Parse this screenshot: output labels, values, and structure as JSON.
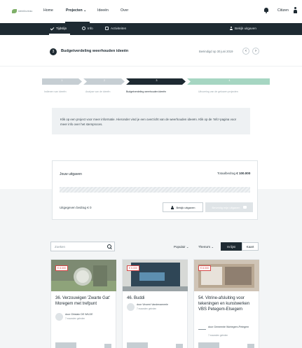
{
  "nav": {
    "logo_text": "stembureau",
    "links": [
      "Home",
      "Projecten",
      "Ideeën",
      "Over"
    ],
    "projecten_caret": "⌄",
    "user_name": "Citizen"
  },
  "subnav": {
    "tabs": [
      "Tijdslijn",
      "Info",
      "Activiteiten"
    ],
    "account_link": "Bekijk uitgaven"
  },
  "step": {
    "number": "3",
    "title": "Budgetverdeling weerhouden ideeën",
    "deadline": "Beëindigd op 30 juni 2019",
    "prev": "‹",
    "next": "›"
  },
  "stepper": {
    "steps": [
      {
        "num": "1",
        "label": "Indienen van ideeën"
      },
      {
        "num": "2",
        "label": "Analyse van de ideeën"
      },
      {
        "num": "3",
        "label": "Budgetverdeling weerhouden ideeën"
      },
      {
        "num": "4",
        "label": "Uitvoering van de gekozen projecten"
      }
    ]
  },
  "info": {
    "text": "Klik op een project voor meer informatie. Hieronder vind je een overzicht van de weerhouden ideeën. Klik op de 'Info'-pagina voor meer info over het stemproces."
  },
  "expenses": {
    "title": "Jouw uitgaven",
    "total_label": "Totaalbedrag",
    "total_value": "€ 100.000",
    "spent_label": "Uitgegeven bedrag",
    "spent_value": "€ 0",
    "view_button": "Bekijk uitgaven",
    "submit_button": "Bevestig mijn uitgaven"
  },
  "filters": {
    "search_placeholder": "Zoeken",
    "sort_label": "Populair",
    "topics_label": "Thema's",
    "view_list": "In lijst",
    "view_map": "Kaart",
    "caret": "⌄"
  },
  "projects": [
    {
      "price": "€ 8.000",
      "title": "36. Verzouwigen 'Zwarte Gat' Moregem met trefpunt",
      "author": "door Ghislain DE WILDE",
      "meta": "7 maanden geleden",
      "img_color": "#8a9a7c"
    },
    {
      "price": "€ 5.000",
      "title": "46. Buddi",
      "author": "door Vincent Vandenameele",
      "meta": "7 maanden geleden",
      "img_color": "#3e5566"
    },
    {
      "price": "€ 8.000",
      "title": "54. Vitrine-afsluiting voor tekeningen en kunstwerken VBS Petegem-Elsegem",
      "author": "door Gemeente Wortegem-Petegem",
      "meta": "7 maanden geleden",
      "img_color": "#c7b8a8"
    }
  ],
  "colors": {
    "primary": "#1e2a32",
    "accent_green": "#a6d6c2",
    "price_red": "#d64545"
  }
}
